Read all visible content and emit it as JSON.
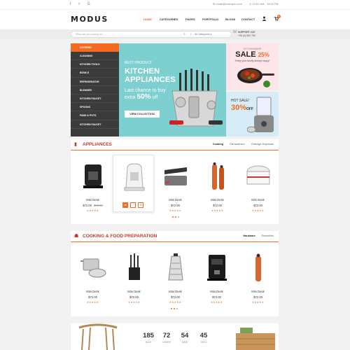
{
  "topbar": {
    "social": [
      "f",
      "t",
      "G"
    ],
    "email": "✉ email@example.com",
    "hours": "◷ 10:00 AM - 18:00 PM"
  },
  "header": {
    "logo": "MODUS",
    "nav": [
      "HOME",
      "CATEGORIES",
      "PAGES",
      "PORTFOLIO",
      "BLOGS",
      "CONTACT"
    ],
    "active_nav": "HOME",
    "cart_count": "0"
  },
  "search": {
    "placeholder": "What are you looking for...",
    "category": "All Categories",
    "support_label": "SUPPORT 24/7",
    "support_phone": "+08 (0) 852 780"
  },
  "sidebar": {
    "heading": "COOKING",
    "items": [
      "CLEANING",
      "KITCHEN TOOLS",
      "BOWLS",
      "REFRIGERATOR",
      "BLENDER",
      "KITCHEN FAUCET",
      "SPOONS",
      "PANS & POTS",
      "KITCHEN FAUCET"
    ]
  },
  "hero": {
    "subtitle": "BEST PRODUCT",
    "title_line1": "KITCHEN",
    "title_line2": "APPLIANCES",
    "desc_line1": "Last chance to buy",
    "desc_prefix": "extra",
    "desc_percent": "50%",
    "desc_suffix": "off",
    "button": "VIEW COLLECTION"
  },
  "banner_sale": {
    "kicker": "KITCHENWARE",
    "title": "SALE",
    "percent": "25%",
    "quote": "\"Keep your family always happy\""
  },
  "banner_hot": {
    "label": "HOT SALE!",
    "percent": "30%",
    "suffix": "OFF"
  },
  "appliances": {
    "title": "APPLIANCES",
    "tabs": [
      "Cooking",
      "Dishwashers",
      "Garbage Disposals"
    ],
    "products": [
      {
        "name": "Mini Desk",
        "price": "$72.00",
        "old_price": "$90.00",
        "stars": "★★★★★"
      },
      {
        "name": "",
        "price": "",
        "old_price": "",
        "stars": ""
      },
      {
        "name": "Mini Desk",
        "price": "$72.00",
        "old_price": "",
        "stars": "★★★★★"
      },
      {
        "name": "Mini Desk",
        "price": "$72.00",
        "old_price": "",
        "stars": "★★★★★"
      },
      {
        "name": "Mini Desk",
        "price": "$72.00",
        "old_price": "",
        "stars": "★★★★★"
      }
    ],
    "quick_buttons": [
      "⇄",
      "♡",
      "⊕"
    ]
  },
  "cooking": {
    "title": "COOKING & FOOD PREPARATION",
    "tabs": [
      "Hardware",
      "Essentials"
    ],
    "products": [
      {
        "name": "Mini Desk",
        "price": "$72.00",
        "stars": "★★★★★"
      },
      {
        "name": "Mini Desk",
        "price": "$72.00",
        "stars": "★★★★★"
      },
      {
        "name": "Mini Desk",
        "price": "$72.00",
        "stars": "★★★★★"
      },
      {
        "name": "Mini Desk",
        "price": "$72.00",
        "stars": "★★★★★"
      },
      {
        "name": "Mini Desk",
        "price": "$72.00",
        "stars": "★★★★★"
      }
    ]
  },
  "countdown": [
    {
      "value": "185",
      "label": "DAYS"
    },
    {
      "value": "72",
      "label": "HOURS"
    },
    {
      "value": "54",
      "label": "MINS"
    },
    {
      "value": "45",
      "label": "SECS"
    }
  ],
  "colors": {
    "accent": "#f26b21",
    "hero_bg": "#7ecfd0",
    "sidebar_bg": "#3b3b3b"
  }
}
